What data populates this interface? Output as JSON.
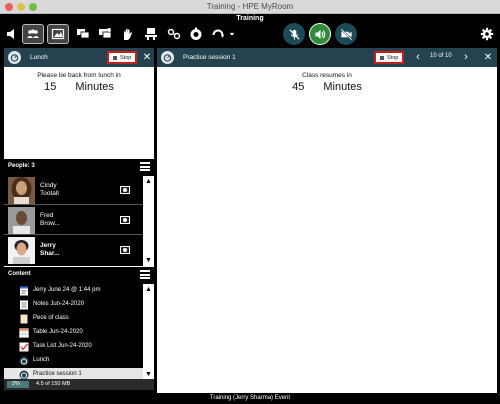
{
  "window": {
    "title": "Training - HPE MyRoom"
  },
  "toolbar": {
    "title": "Training",
    "icons": [
      "speaker-icon",
      "people-icon",
      "image-icon",
      "chat-icon",
      "chat-multi-icon",
      "raise-hand-icon",
      "presenter-icon",
      "link-icon",
      "timer-icon",
      "refresh-icon",
      "chevron-down-icon",
      "mic-muted-icon",
      "speaker-on-icon",
      "camera-off-icon",
      "settings-icon"
    ],
    "colors": {
      "mic_muted": "#1e4a57",
      "speaker_on": "#2e8b3a",
      "camera_off": "#1e4a57"
    }
  },
  "left_panel": {
    "header_label": "Lunch",
    "stop_label": "Stop",
    "message": "Please be back from lunch in",
    "number": "15",
    "unit": "Minutes"
  },
  "right_panel": {
    "header_label": "Practice session 1",
    "stop_label": "Stop",
    "counter": "10 of 10",
    "message": "Class resumes in",
    "number": "45",
    "unit": "Minutes"
  },
  "people": {
    "title": "People: 3",
    "items": [
      {
        "name1": "Cindy",
        "name2": "Tootall",
        "bold": false
      },
      {
        "name1": "Fred",
        "name2": "Brow...",
        "bold": false
      },
      {
        "name1": "Jerry",
        "name2": "Shar...",
        "bold": true
      }
    ]
  },
  "content": {
    "title": "Content",
    "items": [
      {
        "label": "Jerry June 24 @ 1:44 pm",
        "icon": "document-icon"
      },
      {
        "label": "Notes Jun-24-2020",
        "icon": "notes-icon"
      },
      {
        "label": "Pece of class",
        "icon": "file-icon"
      },
      {
        "label": "Table Jun-24-2020",
        "icon": "table-icon"
      },
      {
        "label": "Task List Jun-24-2020",
        "icon": "checklist-icon"
      },
      {
        "label": "Lunch",
        "icon": "timer-icon"
      },
      {
        "label": "Practice session 1",
        "icon": "timer-icon"
      }
    ],
    "selected_index": 6
  },
  "storage": {
    "percent_label": "2%",
    "percent": 2,
    "text": "4.5 of 150 MB"
  },
  "status_bar": {
    "text": "Training (Jerry Sharma) Event"
  }
}
